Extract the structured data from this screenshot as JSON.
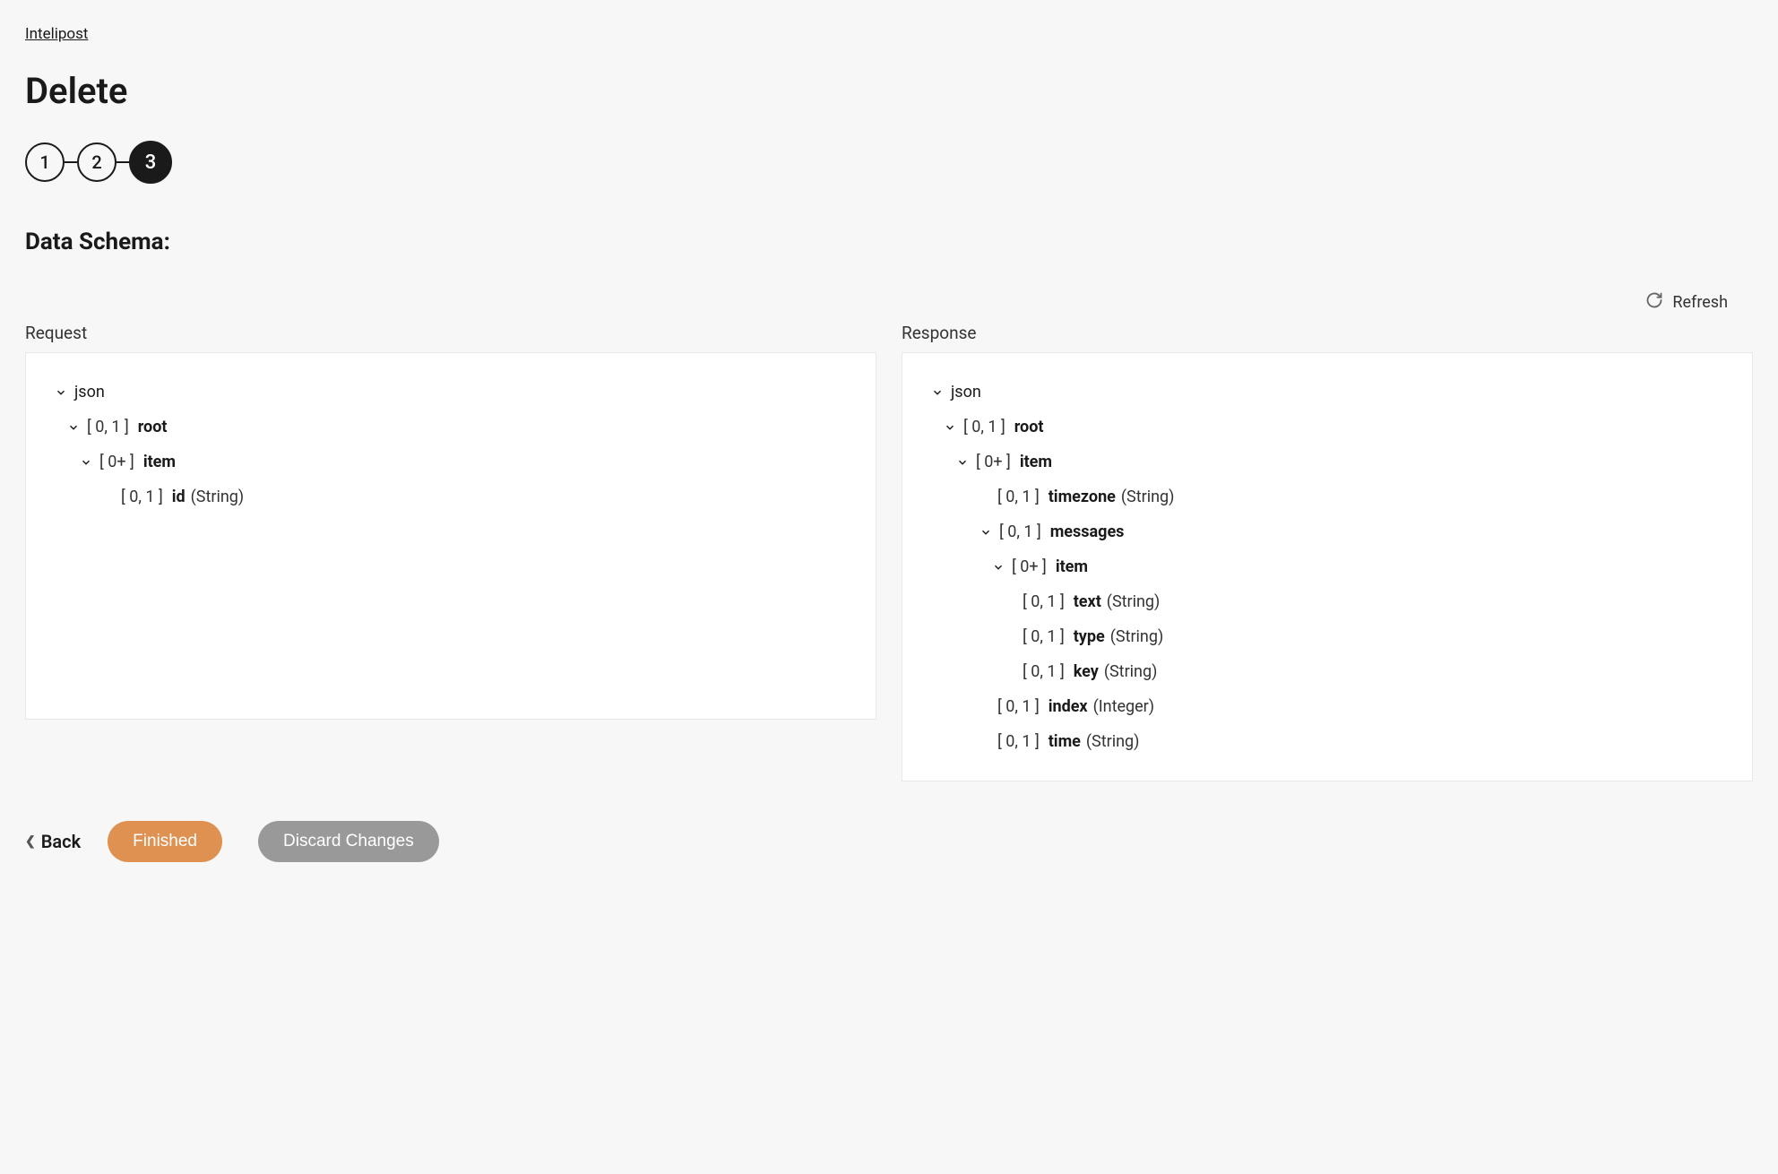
{
  "breadcrumb": "Intelipost",
  "page_title": "Delete",
  "stepper": {
    "steps": [
      "1",
      "2",
      "3"
    ]
  },
  "section_title": "Data Schema:",
  "refresh_label": "Refresh",
  "panels": {
    "request": {
      "label": "Request",
      "rows": [
        {
          "indent": "indent-0",
          "chevron": true,
          "occ": "",
          "name": "json",
          "name_bold": false,
          "type": ""
        },
        {
          "indent": "indent-1",
          "chevron": true,
          "occ": "[ 0, 1 ]",
          "name": "root",
          "name_bold": true,
          "type": ""
        },
        {
          "indent": "indent-2",
          "chevron": true,
          "occ": "[ 0+ ]",
          "name": "item",
          "name_bold": true,
          "type": ""
        },
        {
          "indent": "indent-3nc",
          "chevron": false,
          "occ": "[ 0, 1 ]",
          "name": "id",
          "name_bold": true,
          "type": "(String)"
        }
      ]
    },
    "response": {
      "label": "Response",
      "rows": [
        {
          "indent": "indent-0",
          "chevron": true,
          "occ": "",
          "name": "json",
          "name_bold": false,
          "type": ""
        },
        {
          "indent": "indent-1",
          "chevron": true,
          "occ": "[ 0, 1 ]",
          "name": "root",
          "name_bold": true,
          "type": ""
        },
        {
          "indent": "indent-2",
          "chevron": true,
          "occ": "[ 0+ ]",
          "name": "item",
          "name_bold": true,
          "type": ""
        },
        {
          "indent": "indent-3nc",
          "chevron": false,
          "occ": "[ 0, 1 ]",
          "name": "timezone",
          "name_bold": true,
          "type": "(String)"
        },
        {
          "indent": "indent-3",
          "chevron": true,
          "occ": "[ 0, 1 ]",
          "name": "messages",
          "name_bold": true,
          "type": ""
        },
        {
          "indent": "indent-4",
          "chevron": true,
          "occ": "[ 0+ ]",
          "name": "item",
          "name_bold": true,
          "type": ""
        },
        {
          "indent": "indent-5nc",
          "chevron": false,
          "occ": "[ 0, 1 ]",
          "name": "text",
          "name_bold": true,
          "type": "(String)"
        },
        {
          "indent": "indent-5nc",
          "chevron": false,
          "occ": "[ 0, 1 ]",
          "name": "type",
          "name_bold": true,
          "type": "(String)"
        },
        {
          "indent": "indent-5nc",
          "chevron": false,
          "occ": "[ 0, 1 ]",
          "name": "key",
          "name_bold": true,
          "type": "(String)"
        },
        {
          "indent": "indent-3nc",
          "chevron": false,
          "occ": "[ 0, 1 ]",
          "name": "index",
          "name_bold": true,
          "type": "(Integer)"
        },
        {
          "indent": "indent-3nc",
          "chevron": false,
          "occ": "[ 0, 1 ]",
          "name": "time",
          "name_bold": true,
          "type": "(String)"
        }
      ]
    }
  },
  "footer": {
    "back": "Back",
    "finished": "Finished",
    "discard": "Discard Changes"
  }
}
